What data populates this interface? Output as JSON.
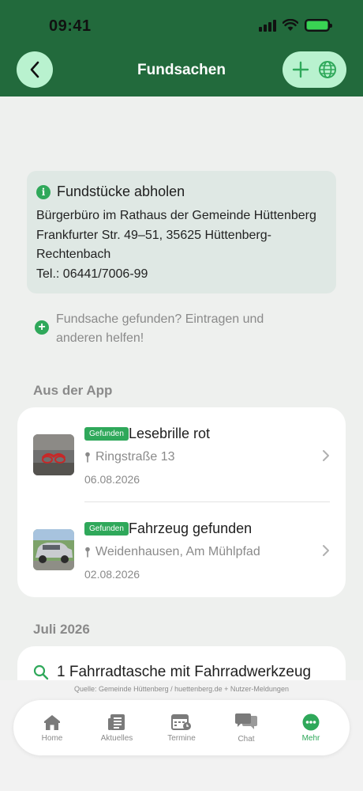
{
  "status_bar": {
    "time": "09:41"
  },
  "header": {
    "title": "Fundsachen"
  },
  "info_box": {
    "title": "Fundstücke abholen",
    "lines": [
      "Bürgerbüro im Rathaus der Gemeinde Hüttenberg",
      "Frankfurter Str. 49–51, 35625 Hüttenberg-",
      "Rechtenbach",
      "Tel.: 06441/7006-99"
    ]
  },
  "add_prompt": {
    "line1": "Fundsache gefunden? Eintragen und",
    "line2": "anderen helfen!"
  },
  "sections": {
    "app": "Aus der App",
    "july": "Juli 2026"
  },
  "app_items": [
    {
      "badge": "Gefunden",
      "title": "Lesebrille rot",
      "location": "Ringstraße 13",
      "date": "06.08.2026"
    },
    {
      "badge": "Gefunden",
      "title": "Fahrzeug gefunden",
      "location": "Weidenhausen, Am Mühlpfad",
      "date": "02.08.2026"
    }
  ],
  "july_items": [
    {
      "title": "1 Fahrradtasche mit Fahrradwerkzeug"
    }
  ],
  "source_note": "Quelle: Gemeinde Hüttenberg / huettenberg.de + Nutzer-Meldungen",
  "tabs": [
    {
      "label": "Home",
      "icon": "home-icon"
    },
    {
      "label": "Aktuelles",
      "icon": "newspaper-icon"
    },
    {
      "label": "Termine",
      "icon": "calendar-icon"
    },
    {
      "label": "Chat",
      "icon": "chat-icon"
    },
    {
      "label": "Mehr",
      "icon": "more-icon",
      "active": true
    }
  ],
  "colors": {
    "header": "#226a3c",
    "accent": "#2fa85a",
    "pill": "#b9f2cf"
  }
}
